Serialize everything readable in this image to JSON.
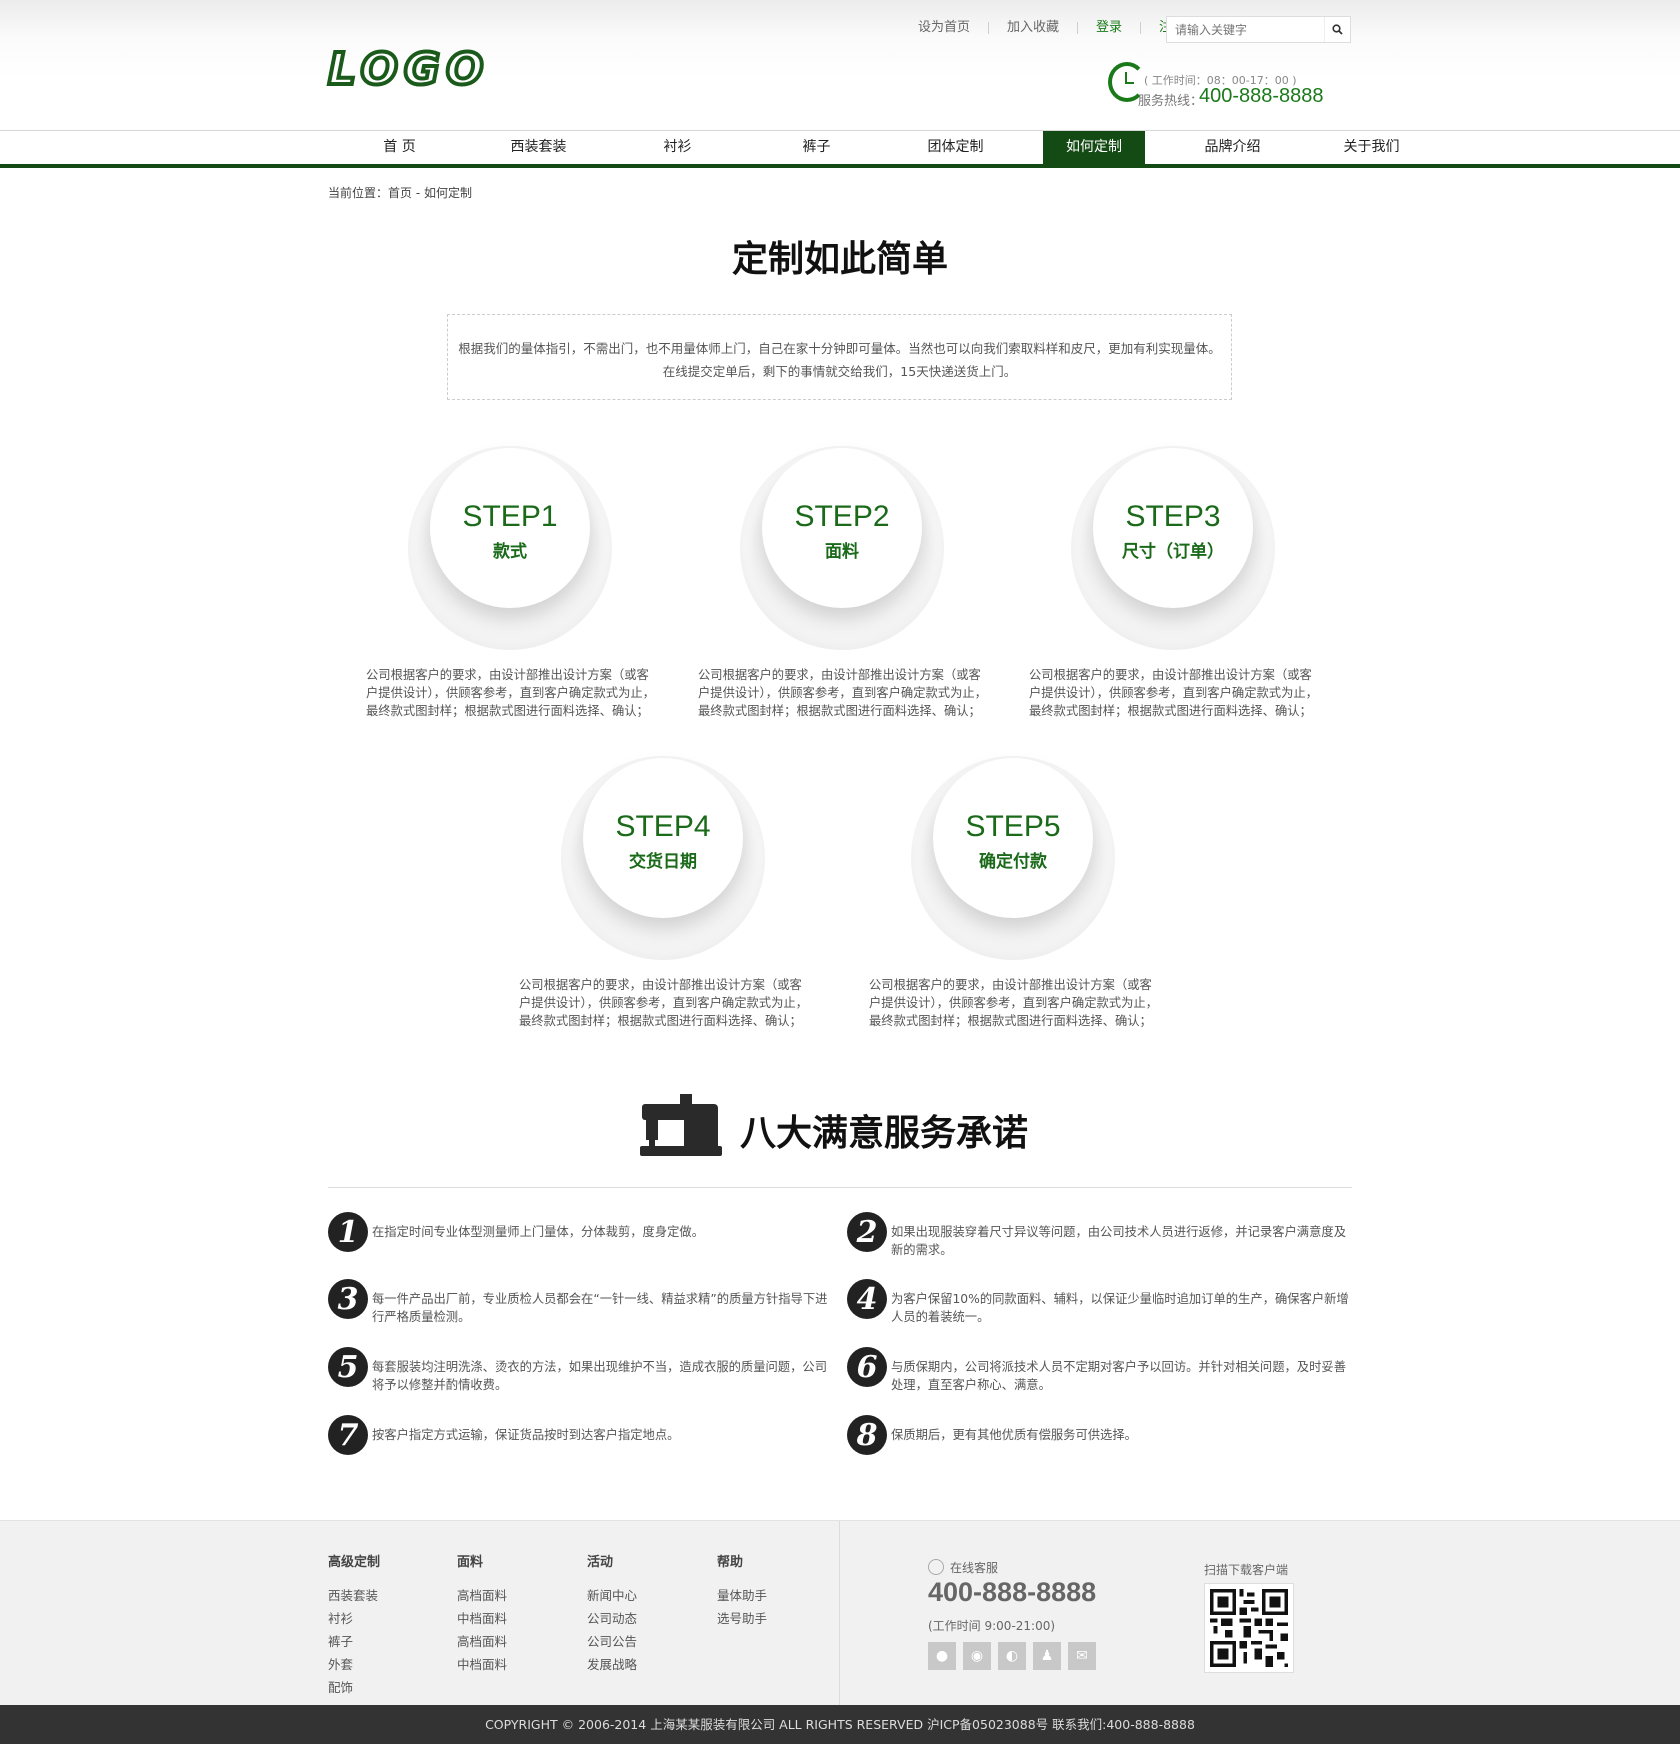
{
  "header": {
    "logo": "LOGO",
    "toplinks": [
      "设为首页",
      "加入收藏",
      "登录",
      "注册"
    ],
    "search_placeholder": "请输入关键字",
    "worktime": "( 工作时间：08：00-17：00 )",
    "hotline_label": "服务热线：",
    "hotline": "400-888-8888"
  },
  "nav": [
    "首 页",
    "西装套装",
    "衬衫",
    "裤子",
    "团体定制",
    "如何定制",
    "品牌介绍",
    "关于我们"
  ],
  "nav_active": 5,
  "breadcrumb": "当前位置：首页 - 如何定制",
  "main": {
    "title": "定制如此简单",
    "intro_line1": "根据我们的量体指引，不需出门，也不用量体师上门，自己在家十分钟即可量体。当然也可以向我们索取料样和皮尺，更加有利实现量体。",
    "intro_line2": "在线提交定单后，剩下的事情就交给我们，15天快递送货上门。"
  },
  "steps": [
    {
      "no": "STEP1",
      "title": "款式",
      "desc": "公司根据客户的要求，由设计部推出设计方案（或客户提供设计），供顾客参考，直到客户确定款式为止，最终款式图封样；根据款式图进行面料选择、确认；"
    },
    {
      "no": "STEP2",
      "title": "面料",
      "desc": "公司根据客户的要求，由设计部推出设计方案（或客户提供设计），供顾客参考，直到客户确定款式为止，最终款式图封样；根据款式图进行面料选择、确认；"
    },
    {
      "no": "STEP3",
      "title": "尺寸（订单）",
      "desc": "公司根据客户的要求，由设计部推出设计方案（或客户提供设计），供顾客参考，直到客户确定款式为止，最终款式图封样；根据款式图进行面料选择、确认；"
    },
    {
      "no": "STEP4",
      "title": "交货日期",
      "desc": "公司根据客户的要求，由设计部推出设计方案（或客户提供设计），供顾客参考，直到客户确定款式为止，最终款式图封样；根据款式图进行面料选择、确认；"
    },
    {
      "no": "STEP5",
      "title": "确定付款",
      "desc": "公司根据客户的要求，由设计部推出设计方案（或客户提供设计），供顾客参考，直到客户确定款式为止，最终款式图封样；根据款式图进行面料选择、确认；"
    }
  ],
  "promise": {
    "title": "八大满意服务承诺",
    "items": [
      {
        "n": "1",
        "text": "在指定时间专业体型测量师上门量体，分体裁剪，度身定做。"
      },
      {
        "n": "2",
        "text": "如果出现服装穿着尺寸异议等问题，由公司技术人员进行返修，并记录客户满意度及新的需求。"
      },
      {
        "n": "3",
        "text": "每一件产品出厂前，专业质检人员都会在“一针一线、精益求精”的质量方针指导下进行严格质量检测。"
      },
      {
        "n": "4",
        "text": "为客户保留10%的同款面料、辅料，以保证少量临时追加订单的生产，确保客户新增人员的着装统一。"
      },
      {
        "n": "5",
        "text": "每套服装均注明洗涤、烫衣的方法，如果出现维护不当，造成衣服的质量问题，公司将予以修整并酌情收费。"
      },
      {
        "n": "6",
        "text": "与质保期内，公司将派技术人员不定期对客户予以回访。并针对相关问题，及时妥善处理，直至客户称心、满意。"
      },
      {
        "n": "7",
        "text": "按客户指定方式运输，保证货品按时到达客户指定地点。"
      },
      {
        "n": "8",
        "text": "保质期后，更有其他优质有偿服务可供选择。"
      }
    ]
  },
  "footer": {
    "cols": [
      {
        "title": "高级定制",
        "links": [
          "西装套装",
          "衬衫",
          "裤子",
          "外套",
          "配饰"
        ]
      },
      {
        "title": "面料",
        "links": [
          "高档面料",
          "中档面料",
          "高档面料",
          "中档面料"
        ]
      },
      {
        "title": "活动",
        "links": [
          "新闻中心",
          "公司动态",
          "公司公告",
          "发展战略"
        ]
      },
      {
        "title": "帮助",
        "links": [
          "量体助手",
          "选号助手"
        ]
      }
    ],
    "kefu_label": "在线客服",
    "phone": "400-888-8888",
    "time": "(工作时间 9:00-21:00)",
    "qr_label": "扫描下载客户端",
    "social_icons": [
      "wechat-icon",
      "weibo-icon",
      "tqq-icon",
      "friends-icon",
      "mail-icon"
    ]
  },
  "copyright": "COPYRIGHT © 2006-2014 上海某某服装有限公司 ALL RIGHTS RESERVED  沪ICP备05023088号  联系我们:400-888-8888",
  "colors": {
    "brand_green": "#1a7a1a",
    "nav_dark": "#144a14"
  }
}
